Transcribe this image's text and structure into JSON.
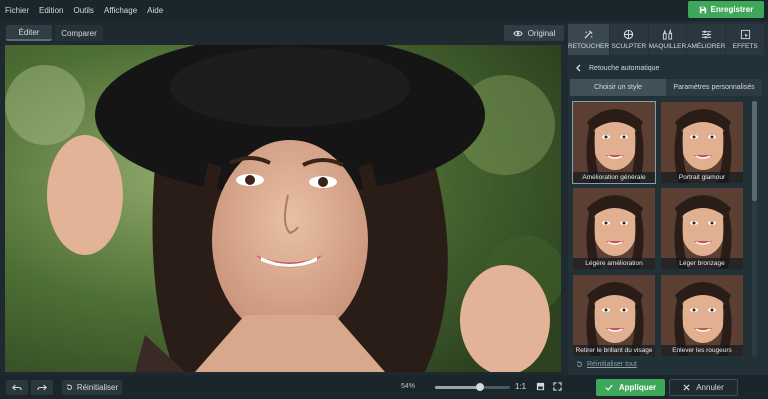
{
  "menu": {
    "items": [
      "Fichier",
      "Edition",
      "Outils",
      "Affichage",
      "Aide"
    ]
  },
  "save_button": {
    "label": "Enregistrer"
  },
  "view_tabs": {
    "edit": "Éditer",
    "compare": "Comparer"
  },
  "original_button": {
    "label": "Original"
  },
  "tools": [
    {
      "label": "RETOUCHER",
      "icon": "retouch-icon",
      "active": true
    },
    {
      "label": "SCULPTER",
      "icon": "sculpt-icon",
      "active": false
    },
    {
      "label": "MAQUILLER",
      "icon": "makeup-icon",
      "active": false
    },
    {
      "label": "AMÉLIORER",
      "icon": "sliders-icon",
      "active": false
    },
    {
      "label": "EFFETS",
      "icon": "effects-icon",
      "active": false
    }
  ],
  "section": {
    "title": "Retouche automatique"
  },
  "subtabs": {
    "style": "Choisir un style",
    "custom": "Paramètres personnalisés"
  },
  "styles": [
    {
      "label": "Amélioration générale",
      "selected": true
    },
    {
      "label": "Portrait glamour",
      "selected": false
    },
    {
      "label": "Légère amélioration",
      "selected": false
    },
    {
      "label": "Léger bronzage",
      "selected": false
    },
    {
      "label": "Retirer le brillant du visage",
      "selected": false
    },
    {
      "label": "Enlever les rougeurs",
      "selected": false
    }
  ],
  "reset_all": {
    "label": "Réinitialiser tout"
  },
  "bottom": {
    "reset_label": "Réinitialiser",
    "zoom": "54%",
    "zoom_fraction": 0.6,
    "ratio": "1:1",
    "apply_label": "Appliquer",
    "cancel_label": "Annuler"
  },
  "colors": {
    "accent": "#3ea85a",
    "panel": "#223037",
    "background": "#1e2a30"
  }
}
